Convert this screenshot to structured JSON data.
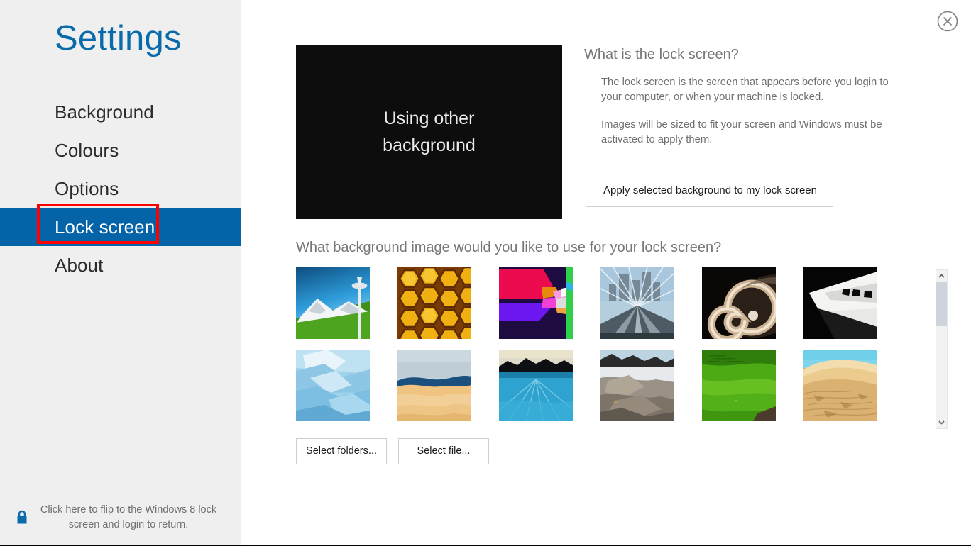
{
  "app": {
    "title": "Settings",
    "accent_color": "#0564A8",
    "title_color": "#0A6BAA",
    "sidebar_bg": "#EFEFEF",
    "highlight_color": "#FF0000"
  },
  "sidebar": {
    "items": [
      {
        "label": "Background",
        "selected": false
      },
      {
        "label": "Colours",
        "selected": false
      },
      {
        "label": "Options",
        "selected": false
      },
      {
        "label": "Lock screen",
        "selected": true
      },
      {
        "label": "About",
        "selected": false
      }
    ],
    "footer": {
      "icon": "lock-icon",
      "text": "Click here to flip to the Windows 8 lock screen and login to return."
    }
  },
  "main": {
    "close_icon": "close-circle-icon",
    "preview": {
      "text": "Using other background",
      "background_color": "#0D0D0D"
    },
    "info": {
      "heading": "What is the lock screen?",
      "paragraphs": [
        "The lock screen is the screen that appears before you login to your computer, or  when your machine is locked.",
        "Images will be sized to fit your screen and Windows must be activated to apply them."
      ],
      "apply_button": "Apply selected background to my lock screen"
    },
    "gallery": {
      "heading": "What background image would you like to use for your lock screen?",
      "thumbnails": [
        {
          "name": "mountain-city-skyline",
          "kind": "photo"
        },
        {
          "name": "honeycomb",
          "kind": "photo"
        },
        {
          "name": "abstract-geometric",
          "kind": "graphic"
        },
        {
          "name": "railway-tunnel",
          "kind": "photo"
        },
        {
          "name": "nautilus-shell",
          "kind": "photo"
        },
        {
          "name": "piano-keys",
          "kind": "photo"
        },
        {
          "name": "ice-glacier",
          "kind": "photo"
        },
        {
          "name": "sand-dune-horizon",
          "kind": "photo"
        },
        {
          "name": "ocean-shoreline",
          "kind": "photo"
        },
        {
          "name": "rocky-coast",
          "kind": "photo"
        },
        {
          "name": "green-hills",
          "kind": "photo"
        },
        {
          "name": "desert-dunes",
          "kind": "photo"
        }
      ],
      "scrollbar": {
        "up_arrow": "chevron-up-icon",
        "down_arrow": "chevron-down-icon"
      }
    },
    "buttons": {
      "select_folders": "Select folders...",
      "select_file": "Select file..."
    }
  }
}
